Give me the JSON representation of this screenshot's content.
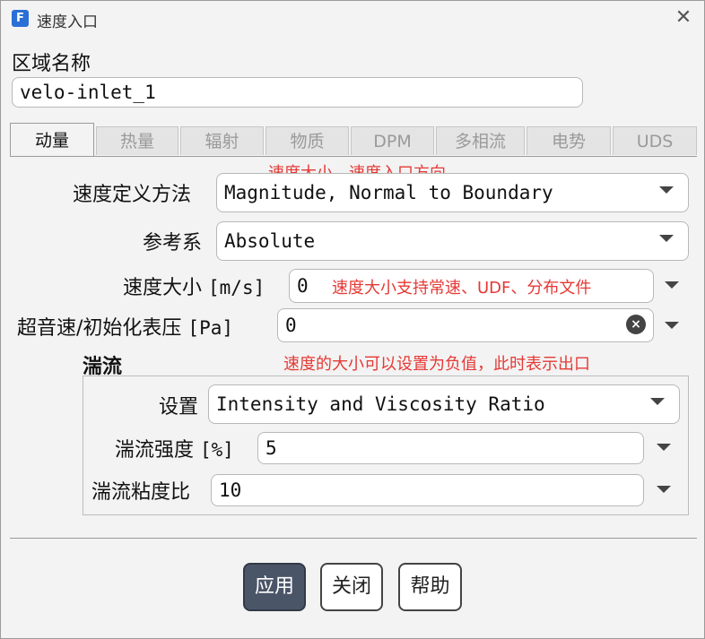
{
  "window": {
    "title": "速度入口",
    "app_icon_letter": "F"
  },
  "zone": {
    "label": "区域名称",
    "value": "velo-inlet_1"
  },
  "tabs": [
    {
      "label": "动量",
      "active": true
    },
    {
      "label": "热量",
      "active": false
    },
    {
      "label": "辐射",
      "active": false
    },
    {
      "label": "物质",
      "active": false
    },
    {
      "label": "DPM",
      "active": false
    },
    {
      "label": "多相流",
      "active": false
    },
    {
      "label": "电势",
      "active": false
    },
    {
      "label": "UDS",
      "active": false
    }
  ],
  "momentum": {
    "velocity_method": {
      "label": "速度定义方法",
      "value": "Magnitude, Normal to Boundary"
    },
    "reference_frame": {
      "label": "参考系",
      "value": "Absolute"
    },
    "velocity_magnitude": {
      "label": "速度大小",
      "unit": "[m/s]",
      "value": "0"
    },
    "pressure": {
      "label": "超音速/初始化表压",
      "unit": "[Pa]",
      "value": "0"
    }
  },
  "turbulence": {
    "header": "湍流",
    "spec": {
      "label": "设置",
      "value": "Intensity and Viscosity Ratio"
    },
    "intensity": {
      "label": "湍流强度",
      "unit": "[%]",
      "value": "5"
    },
    "viscosity_ratio": {
      "label": "湍流粘度比",
      "value": "10"
    }
  },
  "annotations": {
    "a1": "速度大小，速度入口方向",
    "a2": "速度大小支持常速、UDF、分布文件",
    "a3": "速度的大小可以设置为负值，此时表示出口"
  },
  "buttons": {
    "apply": "应用",
    "close": "关闭",
    "help": "帮助"
  },
  "colors": {
    "annotation": "#e53935",
    "primary_button": "#4a5568",
    "app_icon": "#2b6fd6"
  }
}
